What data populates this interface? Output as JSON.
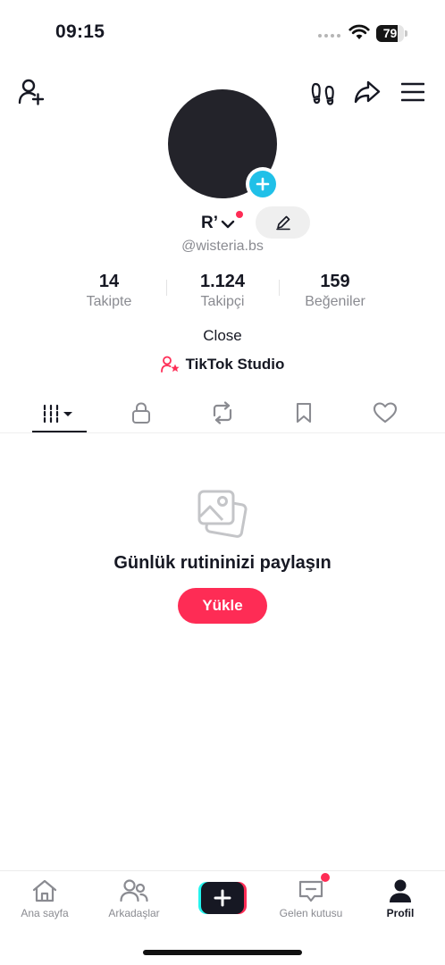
{
  "status_bar": {
    "time": "09:15",
    "battery_percent": 79,
    "battery_label": "79"
  },
  "header": {
    "add_friend_icon": "person-plus-icon",
    "footprints_icon": "footprints-icon",
    "share_icon": "share-arrow-icon",
    "menu_icon": "hamburger-menu-icon"
  },
  "profile": {
    "display_name": "R’",
    "username": "@wisteria.bs",
    "bio": "Close",
    "studio_label": "TikTok Studio",
    "stats": [
      {
        "value": "14",
        "label": "Takipte"
      },
      {
        "value": "1.124",
        "label": "Takipçi"
      },
      {
        "value": "159",
        "label": "Beğeniler"
      }
    ]
  },
  "tabs": [
    {
      "name": "videos",
      "icon": "grid-bars-icon",
      "active": true
    },
    {
      "name": "private",
      "icon": "lock-icon",
      "active": false
    },
    {
      "name": "reposts",
      "icon": "repost-icon",
      "active": false
    },
    {
      "name": "saved",
      "icon": "bookmark-icon",
      "active": false
    },
    {
      "name": "liked",
      "icon": "heart-icon",
      "active": false
    }
  ],
  "empty_state": {
    "icon": "photos-icon",
    "title": "Günlük rutininizi paylaşın",
    "button_label": "Yükle"
  },
  "bottom_nav": {
    "items": [
      {
        "label": "Ana sayfa",
        "icon": "home-icon"
      },
      {
        "label": "Arkadaşlar",
        "icon": "friends-icon"
      },
      {
        "label": "",
        "icon": "plus-icon"
      },
      {
        "label": "Gelen kutusu",
        "icon": "inbox-icon"
      },
      {
        "label": "Profil",
        "icon": "profile-icon"
      }
    ]
  },
  "colors": {
    "accent": "#fe2c55",
    "cyan": "#25f4ee",
    "avatar_add": "#20c0e8",
    "text_primary": "#161823",
    "text_secondary": "#8a8b91"
  }
}
